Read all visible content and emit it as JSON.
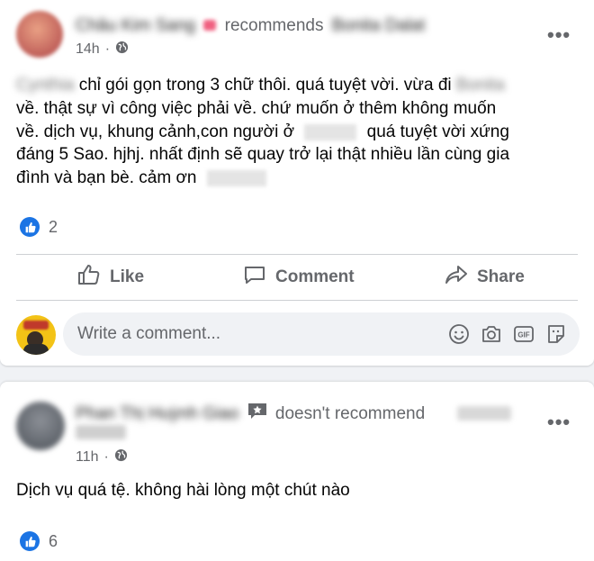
{
  "post1": {
    "author": "Châu Kim Sang",
    "action": "recommends",
    "target": "Bonita Dalat",
    "time": "14h",
    "body_lines": [
      "chỉ gói gọn trong 3 chữ thôi. quá tuyệt vời. vừa đi",
      "về. thật sự vì công việc phải về. chứ muốn ở thêm không muốn",
      "về. dịch vụ, khung cảnh,con người ở",
      "quá tuyệt vời xứng",
      "đáng 5 Sao. hjhj. nhất định sẽ quay trở lại thật nhiều lần cùng gia",
      "đình và bạn bè. cảm ơn"
    ],
    "reactions": "2",
    "actions": {
      "like": "Like",
      "comment": "Comment",
      "share": "Share"
    },
    "comment_placeholder": "Write a comment..."
  },
  "post2": {
    "author": "Phan Thị Huỳnh Giao",
    "action": "doesn't recommend",
    "target": "Bonita Dalat",
    "time": "11h",
    "body": "Dịch vụ quá tệ. không hài lòng một chút nào",
    "reactions": "6"
  },
  "colors": {
    "accent": "#1b74e4",
    "secondary_text": "#65676b",
    "primary_text": "#050505"
  },
  "icons": [
    "globe-icon",
    "more-icon",
    "like-reaction-icon",
    "thumbs-up-icon",
    "comment-icon",
    "share-icon",
    "emoji-icon",
    "camera-icon",
    "gif-icon",
    "sticker-icon",
    "recommend-badge-icon"
  ]
}
